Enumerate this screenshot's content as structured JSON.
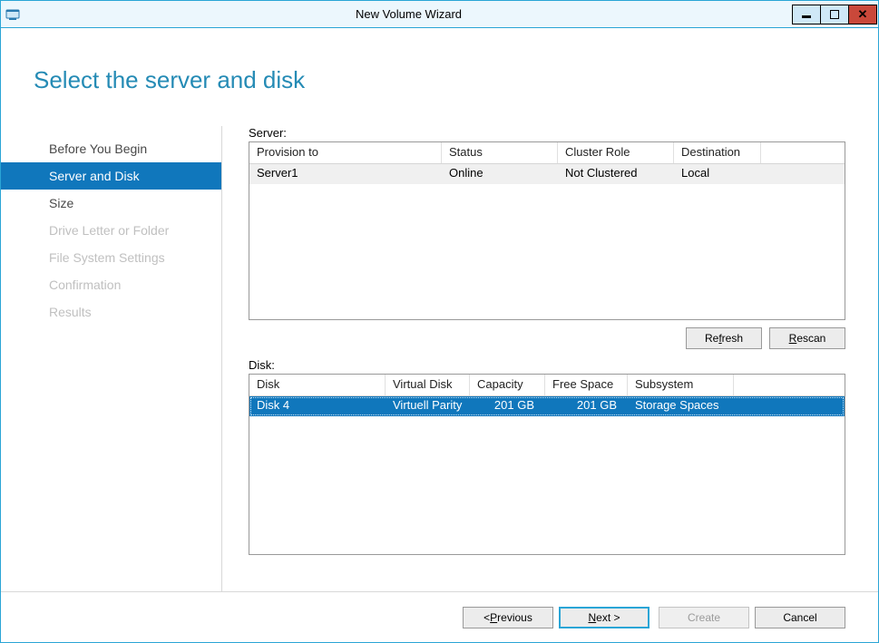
{
  "window": {
    "title": "New Volume Wizard"
  },
  "heading": "Select the server and disk",
  "steps": [
    {
      "label": "Before You Begin",
      "state": "done"
    },
    {
      "label": "Server and Disk",
      "state": "active"
    },
    {
      "label": "Size",
      "state": "done"
    },
    {
      "label": "Drive Letter or Folder",
      "state": "disabled"
    },
    {
      "label": "File System Settings",
      "state": "disabled"
    },
    {
      "label": "Confirmation",
      "state": "disabled"
    },
    {
      "label": "Results",
      "state": "disabled"
    }
  ],
  "server": {
    "label": "Server:",
    "headers": {
      "provision": "Provision to",
      "status": "Status",
      "cluster": "Cluster Role",
      "dest": "Destination"
    },
    "rows": [
      {
        "provision": "Server1",
        "status": "Online",
        "cluster": "Not Clustered",
        "dest": "Local"
      }
    ]
  },
  "refresh_label": "Refresh",
  "rescan_label": "Rescan",
  "rescan_u": "R",
  "refresh_u": "f",
  "disk": {
    "label": "Disk:",
    "headers": {
      "disk": "Disk",
      "vdisk": "Virtual Disk",
      "cap": "Capacity",
      "free": "Free Space",
      "sub": "Subsystem"
    },
    "rows": [
      {
        "disk": "Disk 4",
        "vdisk": "Virtuell Parity",
        "cap": "201 GB",
        "free": "201 GB",
        "sub": "Storage Spaces"
      }
    ]
  },
  "footer": {
    "prev_pre": "< ",
    "prev_u": "P",
    "prev_post": "revious",
    "next_u": "N",
    "next_post": "ext >",
    "create_u": "C",
    "create_post": "reate",
    "cancel": "Cancel"
  }
}
